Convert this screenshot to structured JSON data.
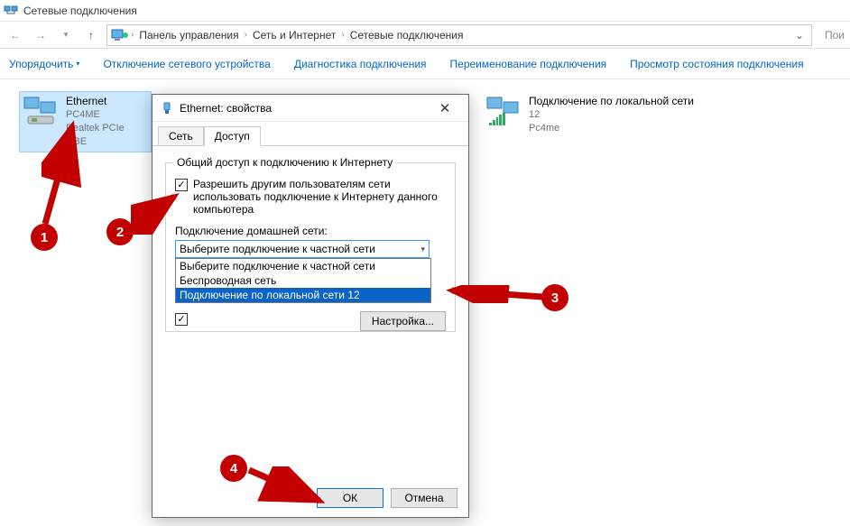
{
  "window_title": "Сетевые подключения",
  "nav": {
    "crumb1": "Панель управления",
    "crumb2": "Сеть и Интернет",
    "crumb3": "Сетевые подключения",
    "search_hint": "Пои"
  },
  "toolbar": {
    "organize": "Упорядочить",
    "disable": "Отключение сетевого устройства",
    "diagnose": "Диагностика подключения",
    "rename": "Переименование подключения",
    "status": "Просмотр состояния подключения"
  },
  "adapters": {
    "ethernet": {
      "name": "Ethernet",
      "line2": "PC4ME",
      "line3": "Realtek PCIe GBE"
    },
    "lan": {
      "name": "Подключение по локальной сети",
      "line2": "12",
      "line3": "Pc4me"
    }
  },
  "dialog": {
    "title": "Ethernet: свойства",
    "tab_network": "Сеть",
    "tab_sharing": "Доступ",
    "group_title": "Общий доступ к подключению к Интернету",
    "chk1": "Разрешить другим пользователям сети использовать подключение к Интернету данного компьютера",
    "home_label": "Подключение домашней сети:",
    "combo_text": "Выберите подключение к частной сети",
    "opt1": "Выберите подключение к частной сети",
    "opt2": "Беспроводная сеть",
    "opt3": "Подключение по локальной сети 12",
    "settings_btn": "Настройка...",
    "ok": "ОК",
    "cancel": "Отмена"
  },
  "callouts": {
    "c1": "1",
    "c2": "2",
    "c3": "3",
    "c4": "4"
  }
}
